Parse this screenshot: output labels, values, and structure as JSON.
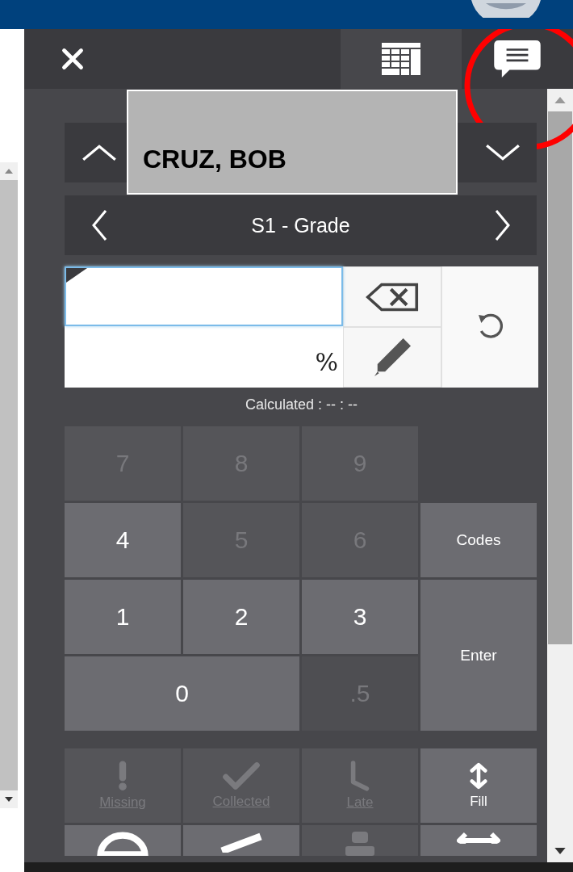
{
  "student": {
    "name": "CRUZ, BOB"
  },
  "assignment": {
    "label": "S1 - Grade"
  },
  "score_field": {
    "suffix": "%"
  },
  "calculated": "Calculated : -- : --",
  "keys": [
    {
      "label": "7",
      "enabled": false,
      "kind": "normal"
    },
    {
      "label": "8",
      "enabled": false,
      "kind": "normal"
    },
    {
      "label": "9",
      "enabled": false,
      "kind": "normal"
    },
    {
      "label": "4",
      "enabled": true,
      "kind": "normal"
    },
    {
      "label": "5",
      "enabled": false,
      "kind": "normal"
    },
    {
      "label": "6",
      "enabled": false,
      "kind": "normal"
    },
    {
      "label": "Codes",
      "enabled": true,
      "kind": "text"
    },
    {
      "label": "1",
      "enabled": true,
      "kind": "normal"
    },
    {
      "label": "2",
      "enabled": true,
      "kind": "normal"
    },
    {
      "label": "3",
      "enabled": true,
      "kind": "normal"
    },
    {
      "label": "Enter",
      "enabled": true,
      "kind": "tall"
    },
    {
      "label": "0",
      "enabled": true,
      "kind": "wide"
    },
    {
      "label": ".5",
      "enabled": false,
      "kind": "normal"
    }
  ],
  "actions": [
    {
      "label": "Missing",
      "enabled": false
    },
    {
      "label": "Collected",
      "enabled": false
    },
    {
      "label": "Late",
      "enabled": false
    },
    {
      "label": "Fill",
      "enabled": true
    }
  ],
  "more_actions": [
    {
      "enabled": true
    },
    {
      "enabled": true
    },
    {
      "enabled": false
    },
    {
      "enabled": true
    }
  ]
}
